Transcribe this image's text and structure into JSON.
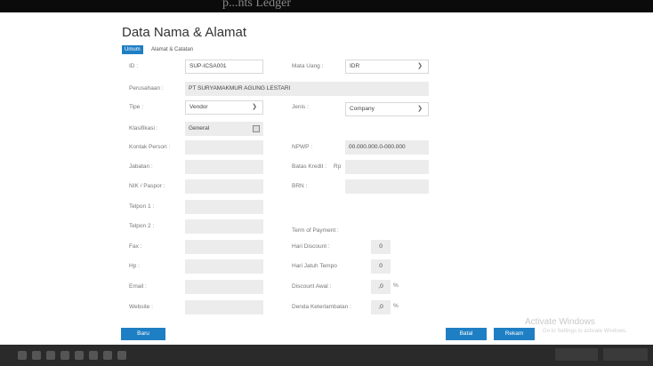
{
  "header": {
    "title": "Data Nama & Alamat",
    "top_caption": "p...nts Ledger"
  },
  "tabs": [
    {
      "label": "Umum"
    },
    {
      "label": "Alamat & Catatan"
    }
  ],
  "left": {
    "id_label": "ID :",
    "id_value": "SUP-ICSA001",
    "perusahaan_label": "Perusahaan :",
    "perusahaan_value": "PT SURYAMAKMUR AGUNG LESTARI",
    "tipe_label": "Tipe :",
    "tipe_value": "Vendor",
    "klasifikasi_label": "Klasifikasi :",
    "klasifikasi_value": "General",
    "kontak_label": "Kontak Person :",
    "jabatan_label": "Jabatan :",
    "nik_label": "NIK / Paspor :",
    "telpon1_label": "Telpon 1 :",
    "telpon2_label": "Telpon 2 :",
    "fax_label": "Fax :",
    "hp_label": "Hp :",
    "email_label": "Email :",
    "website_label": "Website :"
  },
  "right": {
    "mata_uang_label": "Mata Uang :",
    "mata_uang_value": "IDR",
    "jenis_label": "Jenis :",
    "jenis_value": "Company",
    "npwp_label": "NPWP :",
    "npwp_value": "00.000.000.0-000.000",
    "batas_kredit_label": "Batas Kredit :",
    "batas_kredit_currency": "Rp",
    "brn_label": "BRN :",
    "term_label": "Term of Payment :",
    "hari_discount_label": "Hari Discount :",
    "hari_discount_value": "0",
    "hari_jatuh_tempo_label": "Hari Jatuh Tempo",
    "hari_jatuh_tempo_value": "0",
    "discount_awal_label": "Discount Awal :",
    "discount_awal_value": ",0",
    "discount_awal_unit": "%",
    "denda_label": "Denda Keterlambatan :",
    "denda_value": ",0",
    "denda_unit": "%"
  },
  "buttons": {
    "baru": "Baru",
    "batal": "Batal",
    "rekam": "Rekam"
  },
  "watermark": {
    "line1": "Activate Windows",
    "line2": "Go to Settings to activate Windows."
  },
  "colors": {
    "accent": "#1f7fc4",
    "field_bg": "#ececec"
  }
}
